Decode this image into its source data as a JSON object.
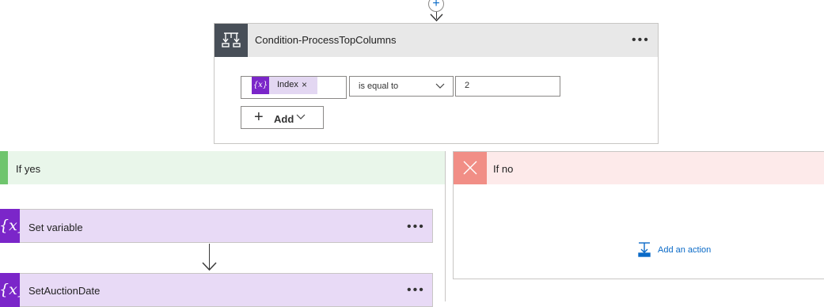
{
  "condition": {
    "title": "Condition-ProcessTopColumns",
    "more_icon": "more-options-icon",
    "operand_token": {
      "icon_text": "{x}",
      "label": "Index",
      "remove": "×"
    },
    "operator": "is equal to",
    "value": "2",
    "add_button": {
      "label": "Add"
    }
  },
  "branches": {
    "yes": {
      "label": "If yes",
      "actions": [
        {
          "title": "Set variable",
          "icon_text": "{x}"
        },
        {
          "title": "SetAuctionDate",
          "icon_text": "{x}"
        }
      ]
    },
    "no": {
      "label": "If no",
      "add_action_label": "Add an action"
    }
  },
  "colors": {
    "condition_header": "#e8e8e8",
    "condition_icon": "#484f58",
    "yes_header": "#e9f6ea",
    "yes_accent": "#6fc56d",
    "no_header": "#fdeaea",
    "no_accent": "#f18e86",
    "variable_accent": "#7b26c9",
    "link": "#0a6ac7"
  }
}
